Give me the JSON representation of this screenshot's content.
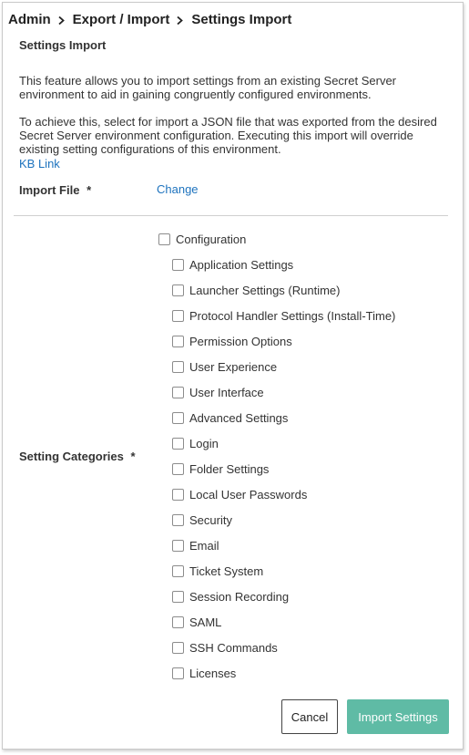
{
  "breadcrumb": {
    "items": [
      "Admin",
      "Export / Import",
      "Settings Import"
    ]
  },
  "section_title": "Settings Import",
  "description": {
    "p1": "This feature allows you to import settings from an existing Secret Server environment to aid in gaining congruently configured environments.",
    "p2": "To achieve this, select for import a JSON file that was exported from the desired Secret Server environment configuration. Executing this import will override existing setting configurations of this environment.",
    "kb_link": "KB Link"
  },
  "import_file": {
    "label": "Import File",
    "required_mark": "*",
    "change_link": "Change"
  },
  "categories": {
    "label": "Setting Categories",
    "required_mark": "*",
    "parent": {
      "label": "Configuration",
      "checked": false
    },
    "items": [
      {
        "label": "Application Settings",
        "checked": false
      },
      {
        "label": "Launcher Settings (Runtime)",
        "checked": false
      },
      {
        "label": "Protocol Handler Settings (Install-Time)",
        "checked": false
      },
      {
        "label": "Permission Options",
        "checked": false
      },
      {
        "label": "User Experience",
        "checked": false
      },
      {
        "label": "User Interface",
        "checked": false
      },
      {
        "label": "Advanced Settings",
        "checked": false
      },
      {
        "label": "Login",
        "checked": false
      },
      {
        "label": "Folder Settings",
        "checked": false
      },
      {
        "label": "Local User Passwords",
        "checked": false
      },
      {
        "label": "Security",
        "checked": false
      },
      {
        "label": "Email",
        "checked": false
      },
      {
        "label": "Ticket System",
        "checked": false
      },
      {
        "label": "Session Recording",
        "checked": false
      },
      {
        "label": "SAML",
        "checked": false
      },
      {
        "label": "SSH Commands",
        "checked": false
      },
      {
        "label": "Licenses",
        "checked": false
      }
    ]
  },
  "buttons": {
    "cancel": "Cancel",
    "import": "Import Settings"
  },
  "colors": {
    "link": "#1e73be",
    "primary_button": "#5fbba5"
  }
}
